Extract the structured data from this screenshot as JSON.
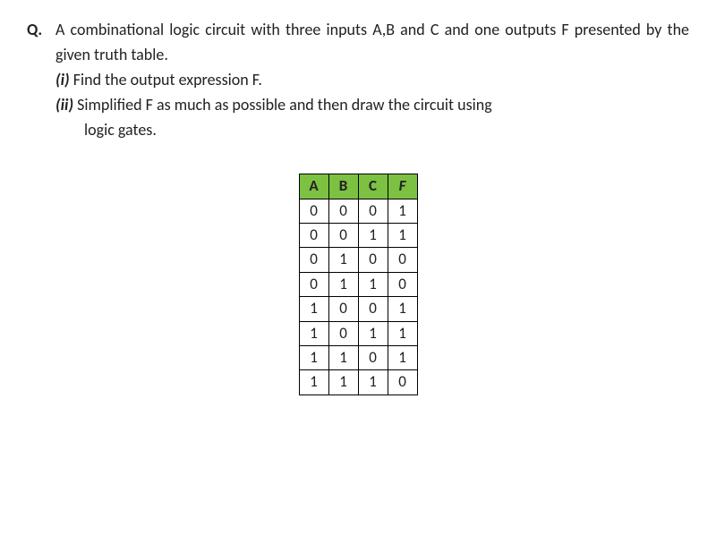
{
  "question": {
    "label": "Q.",
    "main_text": "A combinational logic circuit with three inputs A,B and C and one outputs F  presented by the given truth table.",
    "parts": [
      {
        "label": "(i)",
        "text": "Find the output expression F."
      },
      {
        "label": "(ii)",
        "text": "Simplified F as much as possible and then draw the circuit using",
        "text_cont": "logic gates."
      }
    ]
  },
  "table": {
    "headers": [
      "A",
      "B",
      "C",
      "F"
    ],
    "rows": [
      [
        "0",
        "0",
        "0",
        "1"
      ],
      [
        "0",
        "0",
        "1",
        "1"
      ],
      [
        "0",
        "1",
        "0",
        "0"
      ],
      [
        "0",
        "1",
        "1",
        "0"
      ],
      [
        "1",
        "0",
        "0",
        "1"
      ],
      [
        "1",
        "0",
        "1",
        "1"
      ],
      [
        "1",
        "1",
        "0",
        "1"
      ],
      [
        "1",
        "1",
        "1",
        "0"
      ]
    ]
  }
}
